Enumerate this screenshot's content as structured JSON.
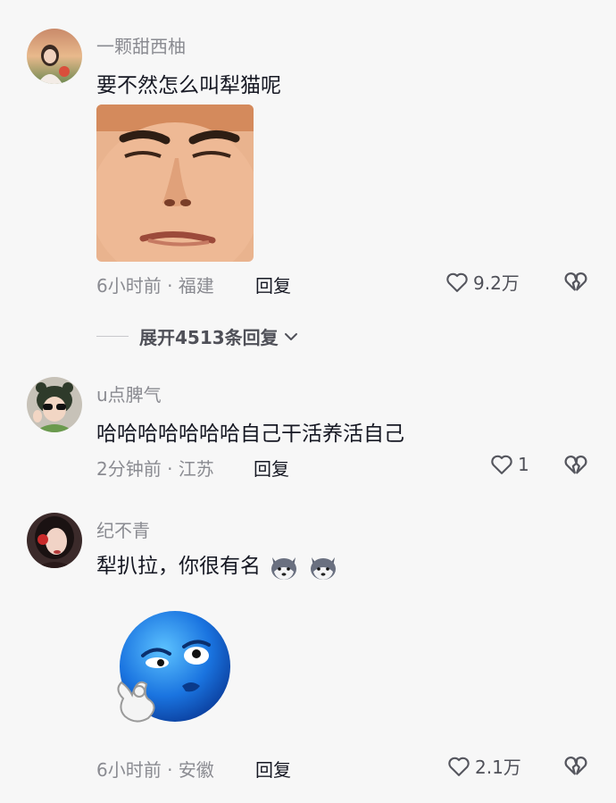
{
  "comments": [
    {
      "username": "一颗甜西柚",
      "text": "要不然怎么叫犁猫呢",
      "time_location": "6小时前 · 福建",
      "reply_label": "回复",
      "likes": "9.2万"
    },
    {
      "username": "u点脾气",
      "text": "哈哈哈哈哈哈哈自己干活养活自己",
      "time_location": "2分钟前 · 江苏",
      "reply_label": "回复",
      "likes": "1"
    },
    {
      "username": "纪不青",
      "text": "犁扒拉，你很有名",
      "time_location": "6小时前 · 安徽",
      "reply_label": "回复",
      "likes": "2.1万"
    }
  ],
  "expand_replies": "展开4513条回复",
  "icons": {
    "like": "heart-outline-icon",
    "dislike": "broken-heart-icon",
    "expand": "chevron-down-icon",
    "inline_emoji": "husky-dog-emoji"
  },
  "colors": {
    "background": "#f7f7f7",
    "primary_text": "#161823",
    "secondary_text": "#8a8b91"
  }
}
